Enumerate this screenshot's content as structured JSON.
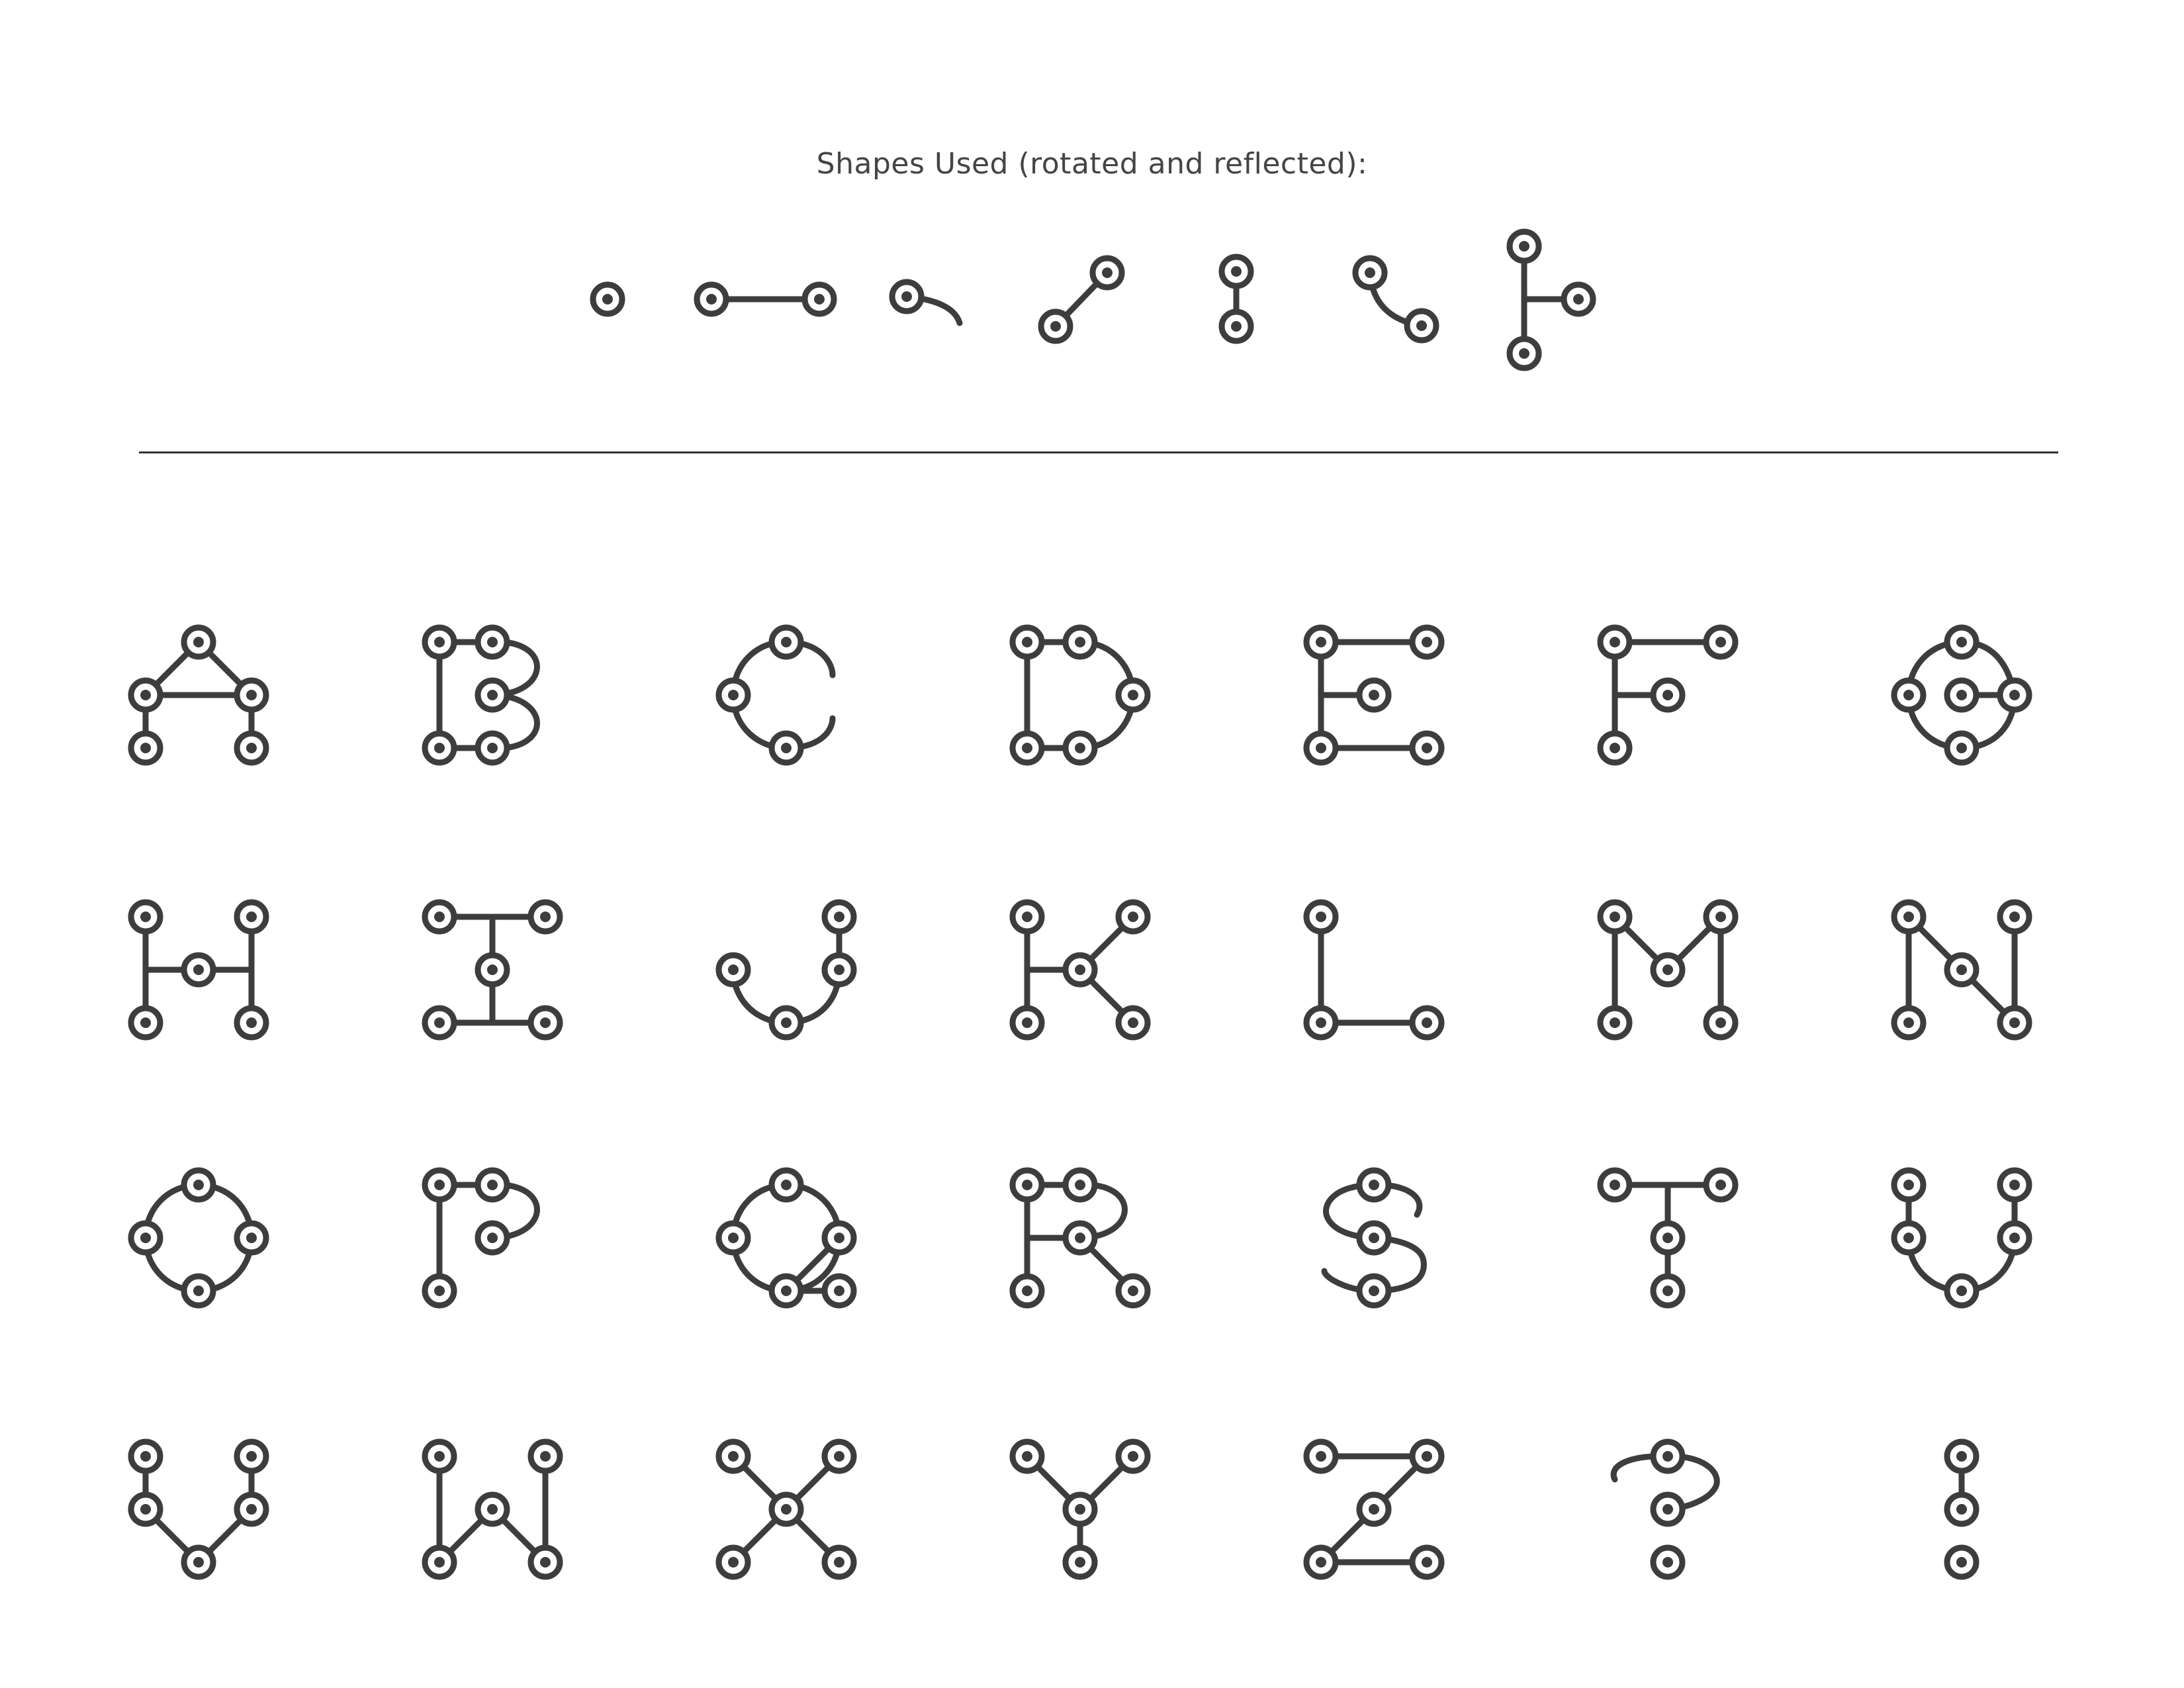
{
  "header": {
    "title": "Shapes Used (rotated and reflected):"
  },
  "style": {
    "ink": "#3d3d3d",
    "background": "#ffffff"
  },
  "shapes": [
    {
      "name": "single-node"
    },
    {
      "name": "straight-connector"
    },
    {
      "name": "curved-tail"
    },
    {
      "name": "diagonal-connector"
    },
    {
      "name": "short-vertical-connector"
    },
    {
      "name": "curved-connector"
    },
    {
      "name": "branch-connector"
    }
  ],
  "glyphs": [
    {
      "char": "A"
    },
    {
      "char": "B"
    },
    {
      "char": "C"
    },
    {
      "char": "D"
    },
    {
      "char": "E"
    },
    {
      "char": "F"
    },
    {
      "char": "G"
    },
    {
      "char": "H"
    },
    {
      "char": "I"
    },
    {
      "char": "J"
    },
    {
      "char": "K"
    },
    {
      "char": "L"
    },
    {
      "char": "M"
    },
    {
      "char": "N"
    },
    {
      "char": "O"
    },
    {
      "char": "P"
    },
    {
      "char": "Q"
    },
    {
      "char": "R"
    },
    {
      "char": "S"
    },
    {
      "char": "T"
    },
    {
      "char": "U"
    },
    {
      "char": "V"
    },
    {
      "char": "W"
    },
    {
      "char": "X"
    },
    {
      "char": "Y"
    },
    {
      "char": "Z"
    },
    {
      "char": "?"
    },
    {
      "char": "!"
    }
  ]
}
